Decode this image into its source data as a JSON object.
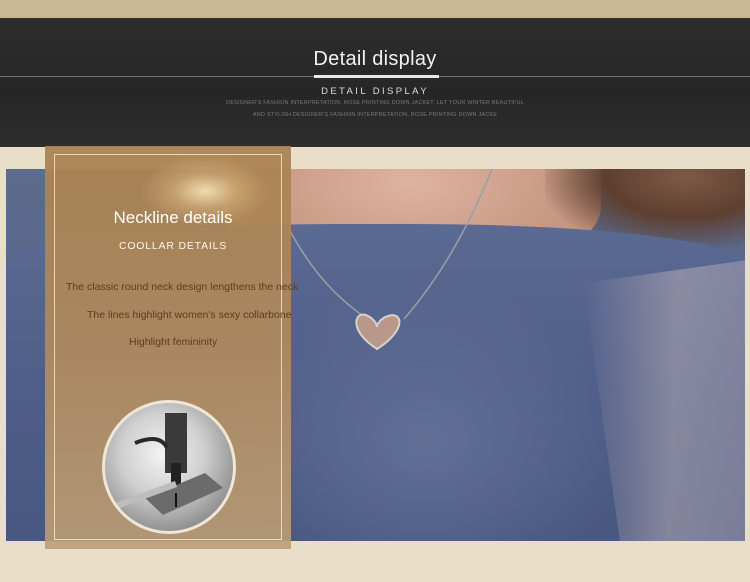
{
  "header": {
    "title": "Detail display",
    "subtitle": "DETAIL DISPLAY",
    "line1": "DESIGNER'S FASHION INTERPRETATION, ROSE PRINTING DOWN JACKET, LET YOUR WINTER BEAUTIFUL",
    "line2": "AND STYLISH DESIGNER'S FASHION INTERPRETATION, ROSE PRINTING DOWN JACKE"
  },
  "panel": {
    "title": "Neckline details",
    "subtitle": "COOLLAR DETAILS",
    "lines": [
      "The classic round neck design lengthens the neck",
      "The lines highlight women's sexy collarbone",
      "Highlight femininity"
    ]
  },
  "colors": {
    "header_bg": "#2b2b2b",
    "page_bg": "#e9dfc9",
    "panel_bg": "#b08a5c",
    "shirt": "#53628a"
  }
}
